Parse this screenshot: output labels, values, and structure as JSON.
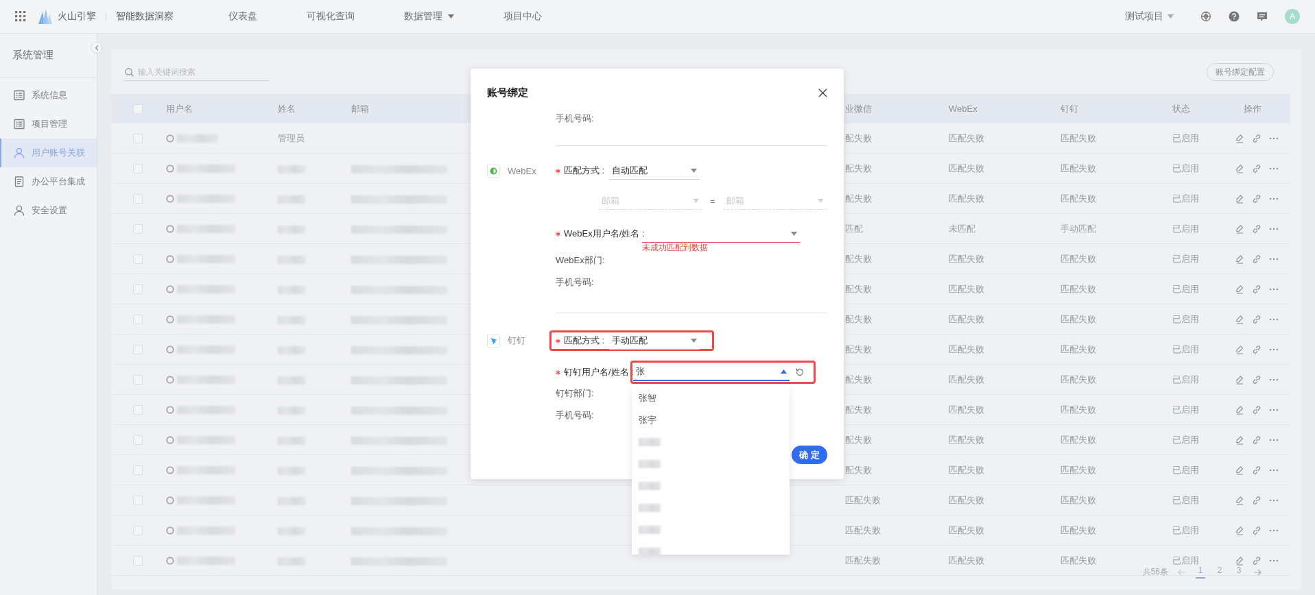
{
  "topbar": {
    "app_name": "火山引擎",
    "product": "智能数据洞察",
    "nav": [
      {
        "label": "仪表盘",
        "kind": "link"
      },
      {
        "label": "可视化查询",
        "kind": "link"
      },
      {
        "label": "数据管理",
        "kind": "menu"
      },
      {
        "label": "项目中心",
        "kind": "link"
      }
    ],
    "project": "测试项目",
    "avatar": "A"
  },
  "sidebar": {
    "title": "系统管理",
    "items": [
      {
        "label": "系统信息",
        "kind": "list",
        "selected": false
      },
      {
        "label": "项目管理",
        "kind": "list",
        "selected": false
      },
      {
        "label": "用户账号关联",
        "kind": "user",
        "selected": true
      },
      {
        "label": "办公平台集成",
        "kind": "doc",
        "selected": false
      },
      {
        "label": "安全设置",
        "kind": "user",
        "selected": false
      }
    ]
  },
  "search": {
    "placeholder": "输入关键词搜索"
  },
  "config_button": "账号绑定配置",
  "table": {
    "select_all_checked": false,
    "columns": [
      "用户名",
      "姓名",
      "邮箱",
      "业微信",
      "WebEx",
      "钉钉",
      "状态",
      "操作"
    ],
    "rows": [
      {
        "checked": false,
        "name": "管理员",
        "email_redacted": false,
        "wecom": "配失败",
        "webex": "匹配失败",
        "dingtalk": "匹配失败",
        "status": "已启用"
      },
      {
        "checked": false,
        "email_redacted": true,
        "wecom": "配失败",
        "webex": "匹配失败",
        "dingtalk": "匹配失败",
        "status": "已启用"
      },
      {
        "checked": false,
        "email_redacted": true,
        "wecom": "配失败",
        "webex": "匹配失败",
        "dingtalk": "匹配失败",
        "status": "已启用"
      },
      {
        "checked": false,
        "email_redacted": true,
        "wecom": "匹配",
        "webex": "未匹配",
        "dingtalk": "手动匹配",
        "status": "已启用"
      },
      {
        "checked": false,
        "email_redacted": true,
        "wecom": "配失败",
        "webex": "匹配失败",
        "dingtalk": "匹配失败",
        "status": "已启用"
      },
      {
        "checked": false,
        "email_redacted": true,
        "wecom": "配失败",
        "webex": "匹配失败",
        "dingtalk": "匹配失败",
        "status": "已启用"
      },
      {
        "checked": false,
        "email_redacted": true,
        "wecom": "配失败",
        "webex": "匹配失败",
        "dingtalk": "匹配失败",
        "status": "已启用"
      },
      {
        "checked": false,
        "email_redacted": true,
        "wecom": "配失败",
        "webex": "匹配失败",
        "dingtalk": "匹配失败",
        "status": "已启用"
      },
      {
        "checked": false,
        "email_redacted": true,
        "wecom": "配失败",
        "webex": "匹配失败",
        "dingtalk": "匹配失败",
        "status": "已启用"
      },
      {
        "checked": false,
        "email_redacted": true,
        "wecom": "配失败",
        "webex": "匹配失败",
        "dingtalk": "匹配失败",
        "status": "已启用"
      },
      {
        "checked": false,
        "email_redacted": true,
        "wecom": "配失败",
        "webex": "匹配失败",
        "dingtalk": "匹配失败",
        "status": "已启用"
      },
      {
        "checked": false,
        "email_redacted": true,
        "wecom": "配失败",
        "webex": "匹配失败",
        "dingtalk": "匹配失败",
        "status": "已启用"
      },
      {
        "checked": false,
        "email_redacted": true,
        "wecom": "匹配失败",
        "webex": "匹配失败",
        "dingtalk": "匹配失败",
        "status": "已启用"
      },
      {
        "checked": false,
        "email_redacted": true,
        "wecom": "匹配失败",
        "webex": "匹配失败",
        "dingtalk": "匹配失败",
        "status": "已启用"
      },
      {
        "checked": false,
        "email_redacted": true,
        "wecom": "匹配失败",
        "webex": "匹配失败",
        "dingtalk": "匹配失败",
        "status": "已启用"
      }
    ]
  },
  "pagination": {
    "total": "共56条",
    "pages": [
      {
        "label": "1",
        "selected": true
      },
      {
        "label": "2",
        "selected": false
      },
      {
        "label": "3",
        "selected": false
      }
    ]
  },
  "modal": {
    "title": "账号绑定",
    "cut_label": "手机号码:",
    "sections": [
      {
        "kind": "webex",
        "platform": "WebEx",
        "match": {
          "label": "匹配方式 :",
          "value": "自动匹配",
          "required": true,
          "highlighted": false
        },
        "mapping": {
          "left": "邮箱",
          "op": "=",
          "right": "邮箱",
          "disabled": true
        },
        "user_field": {
          "label": "WebEx用户名/姓名 :",
          "required": true,
          "focused": false,
          "error": "未成功匹配到数据",
          "highlighted": false
        },
        "dept_label": "WebEx部门:",
        "phone_label": "手机号码:"
      },
      {
        "kind": "dingtalk",
        "platform": "钉钉",
        "match": {
          "label": "匹配方式 :",
          "value": "手动匹配",
          "required": true,
          "highlighted": true
        },
        "user_field": {
          "label": "钉钉用户名/姓名 :",
          "required": true,
          "focused": true,
          "value": "张",
          "highlighted": true,
          "options": [
            {
              "kind": "text",
              "label": "张智"
            },
            {
              "kind": "text",
              "label": "张宇"
            },
            {
              "kind": "redacted"
            },
            {
              "kind": "redacted"
            },
            {
              "kind": "redacted"
            },
            {
              "kind": "redacted"
            },
            {
              "kind": "redacted"
            },
            {
              "kind": "redacted"
            }
          ]
        },
        "dept_label": "钉钉部门:",
        "phone_label": "手机号码:"
      }
    ],
    "confirm": "确 定"
  }
}
